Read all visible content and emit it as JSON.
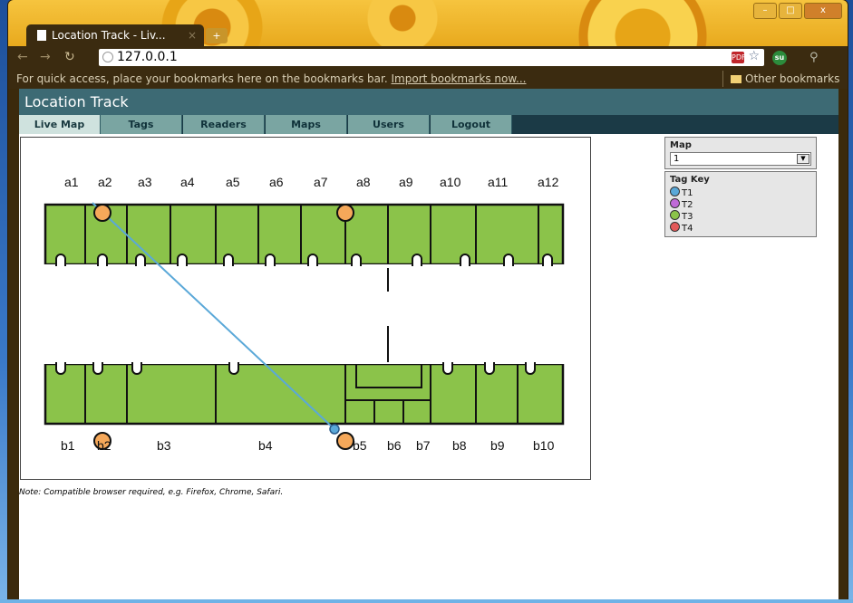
{
  "browser": {
    "tab_title": "Location Track - Liv...",
    "tab_close": "×",
    "new_tab": "+",
    "url": "127.0.0.1",
    "pdf_icon_text": "PDF",
    "su_icon_text": "su",
    "bookmarks_message": "For quick access, place your bookmarks here on the bookmarks bar.",
    "import_link": "Import bookmarks now...",
    "other_bookmarks": "Other bookmarks"
  },
  "app": {
    "title": "Location Track",
    "nav": [
      "Live Map",
      "Tags",
      "Readers",
      "Maps",
      "Users",
      "Logout"
    ],
    "active_tab": "Live Map",
    "note": "Note: Compatible browser required, e.g. Firefox, Chrome, Safari."
  },
  "map": {
    "top_labels": [
      "a1",
      "a2",
      "a3",
      "a4",
      "a5",
      "a6",
      "a7",
      "a8",
      "a9",
      "a10",
      "a11",
      "a12"
    ],
    "bottom_labels": [
      "b1",
      "b2",
      "b3",
      "b4",
      "b5",
      "b6",
      "b7",
      "b8",
      "b9",
      "b10"
    ],
    "colors": {
      "room": "#8bc34a",
      "reader": "#f5a85a",
      "tag_line": "#5aa8d8"
    }
  },
  "sidebar": {
    "map_title": "Map",
    "map_value": "1",
    "tagkey_title": "Tag Key",
    "tags": [
      {
        "label": "T1",
        "color": "#5aa8d8"
      },
      {
        "label": "T2",
        "color": "#c06ad8"
      },
      {
        "label": "T3",
        "color": "#8bc34a"
      },
      {
        "label": "T4",
        "color": "#e35a5a"
      }
    ]
  }
}
